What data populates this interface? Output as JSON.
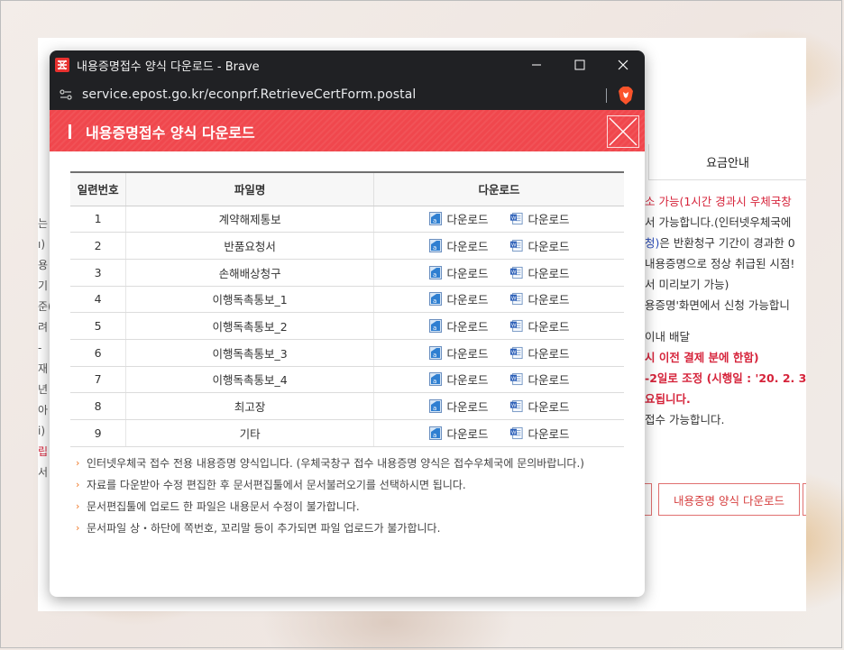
{
  "background_page": {
    "top_line": "",
    "tab_label": "요금안내",
    "left_fragments": [
      "는",
      "ı) ",
      "용",
      "기 ",
      "준(",
      "려",
      "- ",
      "재",
      "년",
      "아",
      "i)",
      "립",
      "서"
    ],
    "right_lines": [
      {
        "text": "소 가능(1시간 경과시 우체국창",
        "style": "red"
      },
      {
        "text": "서 가능합니다.(인터넷우체국에",
        "style": "normal"
      },
      {
        "text": "청)은 반환청구 기간이 경과한 0",
        "style": "blue-start"
      },
      {
        "text": "내용증명으로 정상 취급된 시점!",
        "style": "normal"
      },
      {
        "text": "서 미리보기 가능)",
        "style": "normal"
      },
      {
        "text": "용증명'화면에서 신청 가능합니",
        "style": "normal"
      },
      {
        "text": "",
        "style": "gap"
      },
      {
        "text": "이내 배달",
        "style": "normal"
      },
      {
        "text": "시 이전 결제 분에 한함)",
        "style": "bold-red"
      },
      {
        "text": "-2일로 조정 (시행일 : '20. 2. 3",
        "style": "bold-red"
      },
      {
        "text": "요됩니다.",
        "style": "bold-red"
      },
      {
        "text": "접수 가능합니다.",
        "style": "normal"
      }
    ],
    "download_button": "내용증명 양식 다운로드"
  },
  "window": {
    "title": "내용증명접수 양식 다운로드 - Brave",
    "url": "service.epost.go.kr/econprf.RetrieveCertForm.postal",
    "controls": {
      "minimize": "—",
      "maximize": "☐",
      "close": "✕"
    }
  },
  "page": {
    "title": "내용증명접수 양식 다운로드"
  },
  "table": {
    "headers": [
      "일련번호",
      "파일명",
      "다운로드"
    ],
    "download_label": "다운로드",
    "rows": [
      {
        "no": "1",
        "name": "계약해제통보"
      },
      {
        "no": "2",
        "name": "반품요청서"
      },
      {
        "no": "3",
        "name": "손해배상청구"
      },
      {
        "no": "4",
        "name": "이행독촉통보_1"
      },
      {
        "no": "5",
        "name": "이행독촉통보_2"
      },
      {
        "no": "6",
        "name": "이행독촉통보_3"
      },
      {
        "no": "7",
        "name": "이행독촉통보_4"
      },
      {
        "no": "8",
        "name": "최고장"
      },
      {
        "no": "9",
        "name": "기타"
      }
    ],
    "icons": [
      "hwp-file-icon",
      "word-file-icon"
    ]
  },
  "notes": [
    "인터넷우체국 접수 전용 내용증명 양식입니다. (우체국창구 접수 내용증명 양식은 접수우체국에 문의바랍니다.)",
    "자료를 다운받아 수정 편집한 후 문서편집툴에서 문서불러오기를 선택하시면 됩니다.",
    "문서편집툴에 업로드 한 파일은 내용문서 수정이 불가합니다.",
    "문서파일 상・하단에 쪽번호, 꼬리말 등이 추가되면 파일 업로드가 불가합니다."
  ],
  "colors": {
    "header_red": "#f0474d",
    "titlebar": "#202124",
    "note_arrow": "#f07a2a",
    "bg_red_text": "#d6243b"
  }
}
